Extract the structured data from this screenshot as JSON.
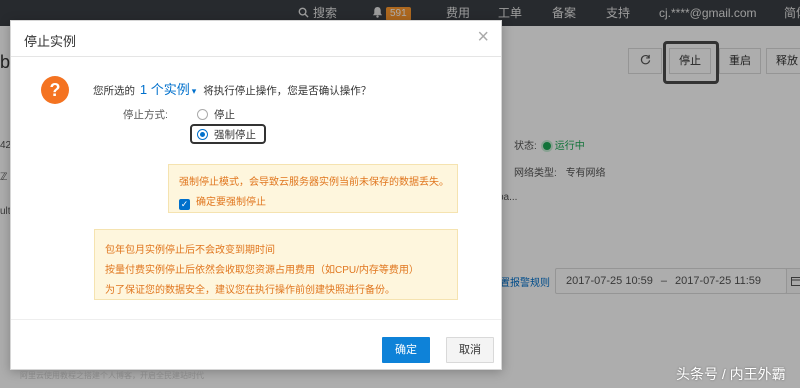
{
  "topnav": {
    "search": "搜索",
    "notifications_count": "591",
    "items": [
      "费用",
      "工单",
      "备案",
      "支持"
    ],
    "account": "cj.****@gmail.com",
    "lang": "简体"
  },
  "background": {
    "toolbar": {
      "refresh_icon": "refresh-icon",
      "stop": "停止",
      "restart": "重启",
      "release": "释放"
    },
    "left_fragments": [
      "b",
      "42",
      "ℤ D",
      "ulta-"
    ],
    "status_label": "状态:",
    "status_value": "运行中",
    "network_label": "网络类型:",
    "network_value": "专有网络",
    "ba_fragment": "ba...",
    "alarm_rule": "置报警规则",
    "date_start": "2017-07-25 10:59",
    "date_sep": "–",
    "date_end": "2017-07-25 11:59"
  },
  "modal": {
    "title": "停止实例",
    "confirm_prefix": "您所选的",
    "confirm_count": "1 个实例",
    "confirm_suffix": "将执行停止操作，您是否确认操作？",
    "mode_label": "停止方式:",
    "options": [
      "停止",
      "强制停止"
    ],
    "selected_option": "强制停止",
    "force_warning": "强制停止模式，会导致云服务器实例当前未保存的数据丢失。",
    "confirm_force": "确定要强制停止",
    "confirm_force_checked": true,
    "notes": [
      "包年包月实例停止后不会改变到期时间",
      "按量付费实例停止后依然会收取您资源占用费用（如CPU/内存等费用）",
      "为了保证您的数据安全，建议您在执行操作前创建快照进行备份。"
    ],
    "ok": "确定",
    "cancel": "取消"
  },
  "bottom_text": "阿里云使用教程之搭建个人博客，开启全民建站时代",
  "watermark": "头条号 / 内王外霸",
  "colors": {
    "accent": "#0070cc",
    "ok_button": "#0e82d8",
    "warning_text": "#e0761e",
    "warning_bg": "#fef6dd",
    "question_icon": "#f47321",
    "status_running": "#1aaa55",
    "badge": "#ff9a2e"
  }
}
